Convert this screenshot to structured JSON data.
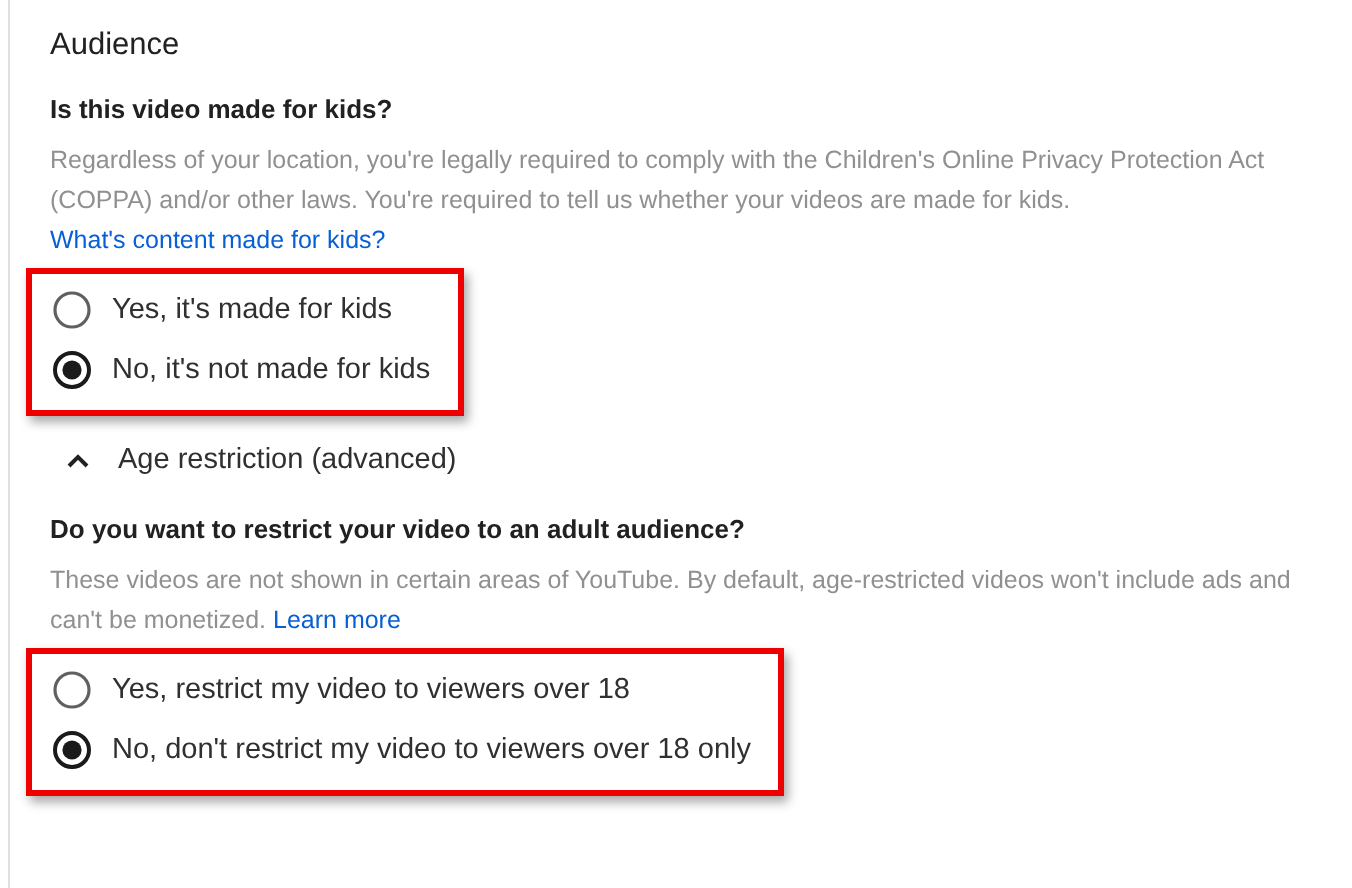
{
  "audience": {
    "title": "Audience",
    "question": "Is this video made for kids?",
    "description": "Regardless of your location, you're legally required to comply with the Children's Online Privacy Protection Act (COPPA) and/or other laws. You're required to tell us whether your videos are made for kids.",
    "link": "What's content made for kids?",
    "highlighted": true,
    "options": [
      {
        "label": "Yes, it's made for kids",
        "selected": false
      },
      {
        "label": "No, it's not made for kids",
        "selected": true
      }
    ]
  },
  "age_restriction": {
    "title": "Age restriction (advanced)",
    "expanded": true,
    "question": "Do you want to restrict your video to an adult audience?",
    "description": "These videos are not shown in certain areas of YouTube. By default, age-restricted videos won't include ads and can't be monetized.",
    "link": "Learn more",
    "highlighted": true,
    "options": [
      {
        "label": "Yes, restrict my video to viewers over 18",
        "selected": false
      },
      {
        "label": "No, don't restrict my video to viewers over 18 only",
        "selected": true
      }
    ]
  }
}
